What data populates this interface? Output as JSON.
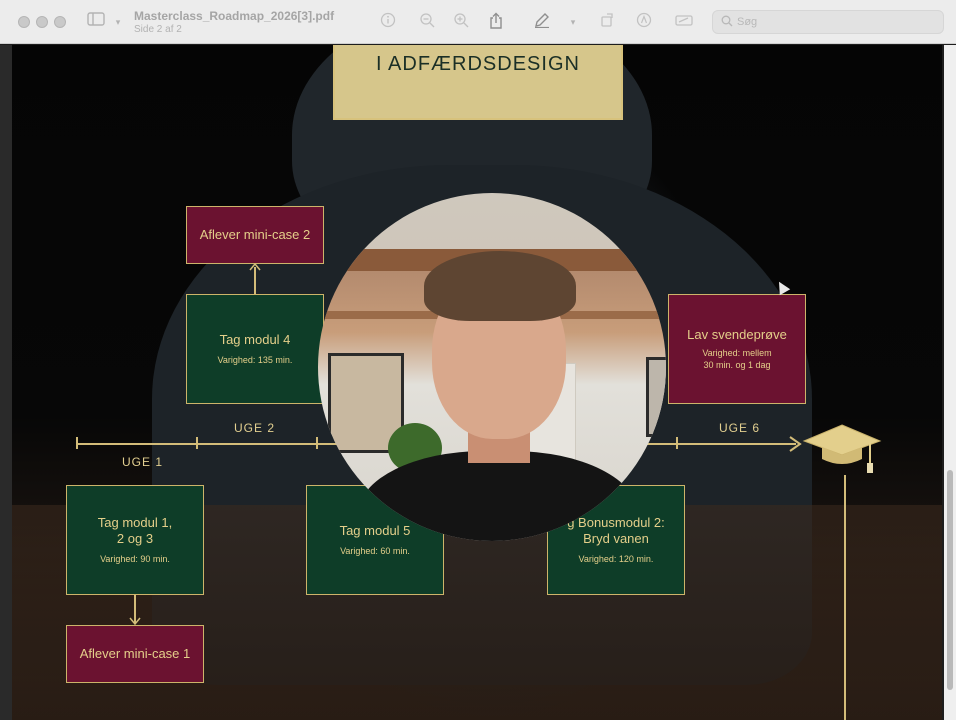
{
  "window": {
    "doc_title": "Masterclass_Roadmap_2026[3].pdf",
    "doc_subtitle": "Side 2 af 2",
    "search_placeholder": "Søg"
  },
  "page": {
    "title": "I ADFÆRDSDESIGN",
    "weeks": {
      "uge1": "UGE 1",
      "uge2": "UGE 2",
      "uge6": "UGE 6"
    },
    "boxes": {
      "mini_case_2": {
        "title": "Aflever mini-case 2"
      },
      "modul_4": {
        "title": "Tag modul 4",
        "sub": "Varighed: 135 min."
      },
      "svendeprove": {
        "title": "Lav svendeprøve",
        "sub1": "Varighed: mellem",
        "sub2": "30 min. og 1 dag"
      },
      "modul_123": {
        "title1": "Tag modul 1,",
        "title2": "2 og 3",
        "sub": "Varighed: 90 min."
      },
      "modul_5": {
        "title": "Tag modul 5",
        "sub": "Varighed: 60 min."
      },
      "bonus": {
        "title1": "g Bonusmodul 2:",
        "title2": "Bryd vanen",
        "sub": "Varighed: 120 min."
      },
      "mini_case_1": {
        "title": "Aflever mini-case 1"
      }
    }
  },
  "colors": {
    "green_box": "#0e3d28",
    "red_box": "#6b1230",
    "gold": "#d3bc79",
    "title_bg": "#d6c68b"
  }
}
